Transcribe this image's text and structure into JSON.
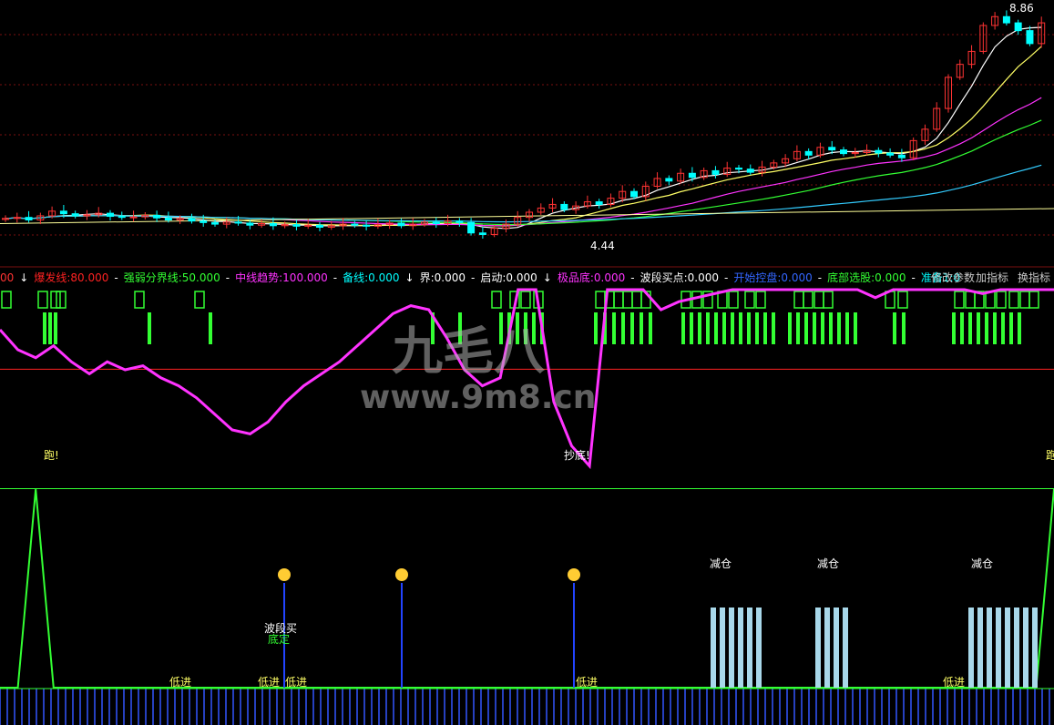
{
  "price_panel": {
    "high_label": "8.86",
    "low_label": "4.44"
  },
  "indicator_legend": [
    {
      "text": "00",
      "color": "#ff3333"
    },
    {
      "text": "↓",
      "color": "#ffffff"
    },
    {
      "text": "爆发线:80.000",
      "color": "#ff2222"
    },
    {
      "text": "-",
      "color": "#ffffff"
    },
    {
      "text": "强弱分界线:50.000",
      "color": "#33ff33"
    },
    {
      "text": "-",
      "color": "#ffffff"
    },
    {
      "text": "中线趋势:100.000",
      "color": "#ff33ff"
    },
    {
      "text": "-",
      "color": "#ffffff"
    },
    {
      "text": "备线:0.000",
      "color": "#00ffff"
    },
    {
      "text": "↓",
      "color": "#ffffff"
    },
    {
      "text": "界:0.000",
      "color": "#ffffff"
    },
    {
      "text": "-",
      "color": "#ffffff"
    },
    {
      "text": "启动:0.000",
      "color": "#ffffff"
    },
    {
      "text": "↓",
      "color": "#ffffff"
    },
    {
      "text": "极品底:0.000",
      "color": "#ff33ff"
    },
    {
      "text": "-",
      "color": "#ffffff"
    },
    {
      "text": "波段买点:0.000",
      "color": "#ffffff"
    },
    {
      "text": "-",
      "color": "#ffffff"
    },
    {
      "text": "开始控盘:0.000",
      "color": "#3366ff"
    },
    {
      "text": "-",
      "color": "#ffffff"
    },
    {
      "text": "底部选股:0.000",
      "color": "#33ff33"
    },
    {
      "text": "-",
      "color": "#ffffff"
    },
    {
      "text": "准备1:0",
      "color": "#00ffff"
    }
  ],
  "toolbar": {
    "modify_params": "修改参数",
    "add_indicator": "加指标",
    "switch_indicator": "换指标"
  },
  "watermark": {
    "line1": "九毛八",
    "line2": "www.9m8.cn"
  },
  "signals": {
    "run_left": "跑!",
    "run_right": "跑",
    "bottom_fish": "抄底!",
    "reduce": "减仓",
    "wave_buy": "波段买",
    "bottom_confirm": "底定",
    "low_enter": "低进"
  },
  "colors": {
    "up_candle": "#ff3333",
    "down_candle": "#00ffff",
    "ma_white": "#ffffff",
    "ma_yellow": "#ffff66",
    "ma_magenta": "#ff33ff",
    "ma_green": "#33ff33",
    "ma_cyan": "#33ccff",
    "grid": "#7a1010",
    "signal_green": "#33ff33",
    "reduce_bar": "#a8d8ea"
  },
  "chart_data": [
    {
      "type": "candlestick",
      "title": "",
      "ylim": [
        4.3,
        8.9
      ],
      "high_value": 8.86,
      "low_value": 4.44,
      "close": [
        4.83,
        4.85,
        4.8,
        4.88,
        4.97,
        4.92,
        4.88,
        4.9,
        4.93,
        4.87,
        4.85,
        4.86,
        4.89,
        4.84,
        4.8,
        4.83,
        4.78,
        4.75,
        4.72,
        4.76,
        4.74,
        4.7,
        4.73,
        4.69,
        4.71,
        4.68,
        4.7,
        4.66,
        4.69,
        4.72,
        4.7,
        4.68,
        4.71,
        4.74,
        4.69,
        4.72,
        4.76,
        4.73,
        4.78,
        4.75,
        4.55,
        4.52,
        4.64,
        4.72,
        4.85,
        4.95,
        5.03,
        5.1,
        5.0,
        5.07,
        5.15,
        5.1,
        5.22,
        5.35,
        5.25,
        5.45,
        5.6,
        5.55,
        5.7,
        5.62,
        5.75,
        5.68,
        5.8,
        5.78,
        5.72,
        5.82,
        5.9,
        5.98,
        6.12,
        6.05,
        6.2,
        6.15,
        6.08,
        6.1,
        6.14,
        6.09,
        6.05,
        6.0,
        6.33,
        6.55,
        6.95,
        7.55,
        7.8,
        8.05,
        8.55,
        8.72,
        8.6,
        8.45,
        8.2,
        8.6
      ],
      "moving_averages": [
        "white",
        "yellow",
        "magenta",
        "green",
        "cyan"
      ]
    },
    {
      "type": "line",
      "title": "",
      "ylim": [
        0,
        100
      ],
      "reference_lines": [
        {
          "name": "爆发线",
          "value": 80
        },
        {
          "name": "强弱分界线",
          "value": 50
        }
      ],
      "series": [
        {
          "name": "中线趋势",
          "values": [
            80,
            70,
            66,
            72,
            64,
            58,
            64,
            60,
            62,
            56,
            52,
            46,
            38,
            30,
            28,
            34,
            44,
            52,
            58,
            64,
            72,
            80,
            88,
            92,
            90,
            76,
            60,
            52,
            56,
            100,
            100,
            44,
            22,
            12,
            100,
            100,
            100,
            90,
            94,
            96,
            98,
            100,
            100,
            100,
            100,
            100,
            100,
            100,
            100,
            96,
            100,
            100,
            100,
            100,
            100,
            98,
            100,
            100,
            100,
            100
          ]
        }
      ]
    },
    {
      "type": "line",
      "title": "",
      "ylim": [
        0,
        100
      ],
      "series": [
        {
          "values": [
            0,
            0,
            100,
            0,
            0,
            0,
            0,
            0,
            0,
            0,
            0,
            0,
            0,
            0,
            0,
            0,
            0,
            0,
            0,
            0,
            0,
            0,
            0,
            0,
            0,
            0,
            0,
            0,
            0,
            0,
            0,
            0,
            0,
            0,
            0,
            0,
            0,
            0,
            0,
            0,
            0,
            0,
            0,
            0,
            0,
            0,
            0,
            0,
            0,
            0,
            0,
            0,
            0,
            0,
            0,
            0,
            0,
            0,
            0,
            100
          ]
        }
      ]
    }
  ]
}
